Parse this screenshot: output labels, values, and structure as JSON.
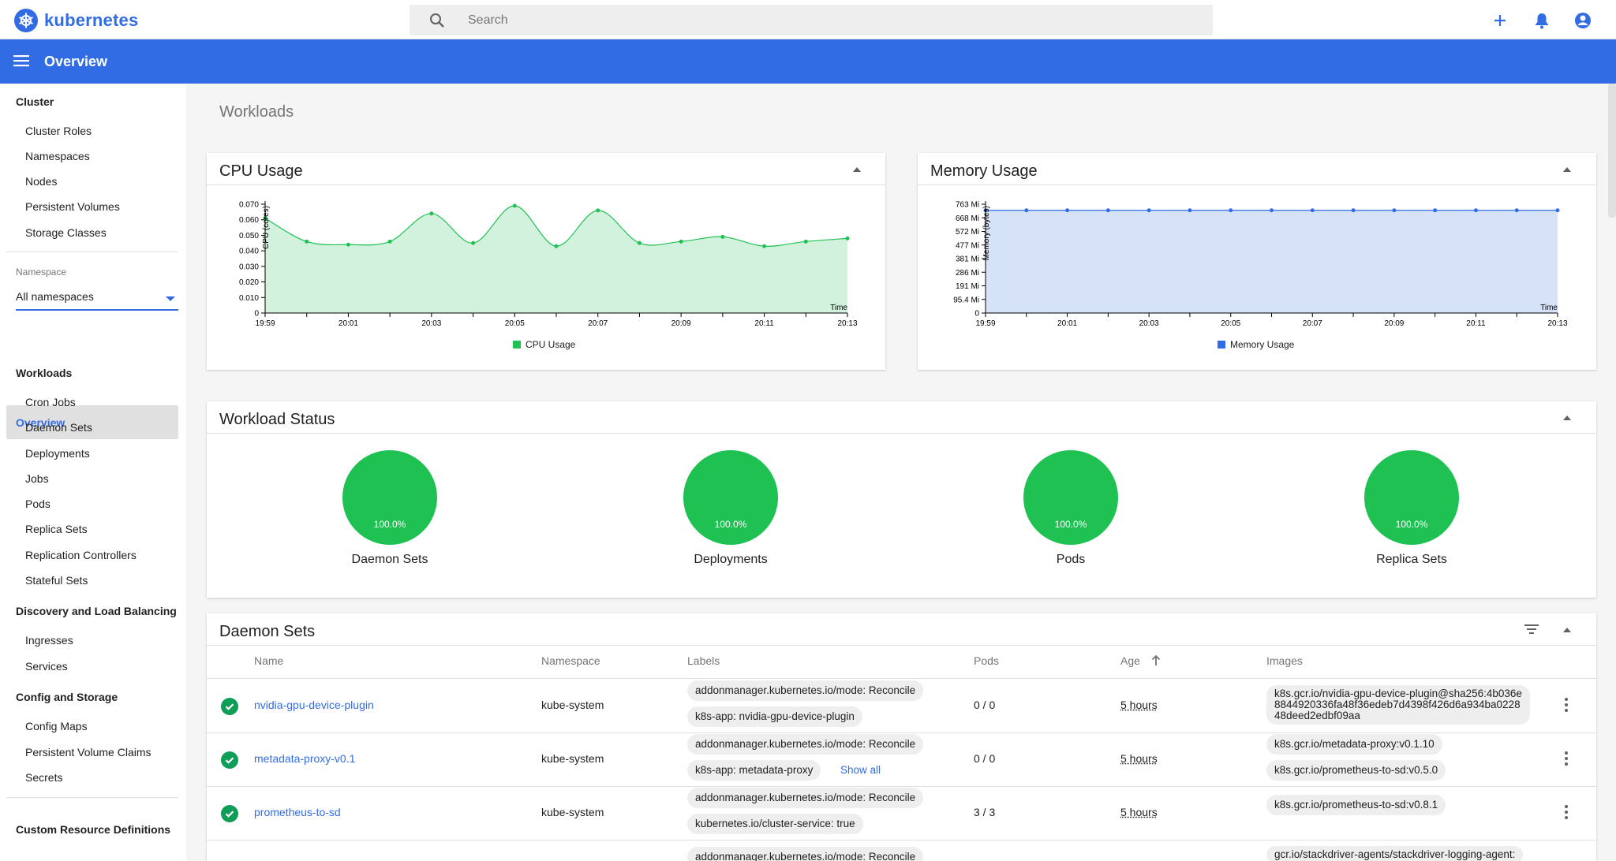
{
  "app": {
    "logo_text": "kubernetes"
  },
  "search": {
    "placeholder": "Search"
  },
  "toolbar": {
    "title": "Overview"
  },
  "sidebar": {
    "cluster": {
      "heading": "Cluster",
      "items": [
        "Cluster Roles",
        "Namespaces",
        "Nodes",
        "Persistent Volumes",
        "Storage Classes"
      ]
    },
    "namespace": {
      "label": "Namespace",
      "value": "All namespaces"
    },
    "overview": "Overview",
    "workloads": {
      "heading": "Workloads",
      "items": [
        "Cron Jobs",
        "Daemon Sets",
        "Deployments",
        "Jobs",
        "Pods",
        "Replica Sets",
        "Replication Controllers",
        "Stateful Sets"
      ]
    },
    "discovery": {
      "heading": "Discovery and Load Balancing",
      "items": [
        "Ingresses",
        "Services"
      ]
    },
    "config": {
      "heading": "Config and Storage",
      "items": [
        "Config Maps",
        "Persistent Volume Claims",
        "Secrets"
      ]
    },
    "crd": "Custom Resource Definitions"
  },
  "main": {
    "heading": "Workloads"
  },
  "cpu_card": {
    "title": "CPU Usage"
  },
  "memory_card": {
    "title": "Memory Usage"
  },
  "chart_data": [
    {
      "type": "area",
      "title": "CPU Usage",
      "xlabel": "Time",
      "ylabel": "CPU (cores)",
      "x": [
        "19:59",
        "20:00",
        "20:01",
        "20:02",
        "20:03",
        "20:04",
        "20:05",
        "20:06",
        "20:07",
        "20:08",
        "20:09",
        "20:10",
        "20:11",
        "20:12",
        "20:13"
      ],
      "x_ticks": [
        "19:59",
        "20:01",
        "20:03",
        "20:05",
        "20:07",
        "20:09",
        "20:11",
        "20:13"
      ],
      "y_ticks": [
        "0",
        "0.010",
        "0.020",
        "0.030",
        "0.040",
        "0.050",
        "0.060",
        "0.070"
      ],
      "ylim": [
        0,
        0.07
      ],
      "series": [
        {
          "name": "CPU Usage",
          "color": "#1fc252",
          "fill": "#d2f2dd",
          "values": [
            0.061,
            0.046,
            0.044,
            0.046,
            0.064,
            0.045,
            0.069,
            0.043,
            0.066,
            0.045,
            0.046,
            0.049,
            0.043,
            0.046,
            0.048
          ]
        }
      ],
      "legend": "bottom"
    },
    {
      "type": "area",
      "title": "Memory Usage",
      "xlabel": "Time",
      "ylabel": "Memory (bytes)",
      "x": [
        "19:59",
        "20:00",
        "20:01",
        "20:02",
        "20:03",
        "20:04",
        "20:05",
        "20:06",
        "20:07",
        "20:08",
        "20:09",
        "20:10",
        "20:11",
        "20:12",
        "20:13"
      ],
      "x_ticks": [
        "19:59",
        "20:01",
        "20:03",
        "20:05",
        "20:07",
        "20:09",
        "20:11",
        "20:13"
      ],
      "y_ticks": [
        "0",
        "95.4 Mi",
        "191 Mi",
        "286 Mi",
        "381 Mi",
        "477 Mi",
        "572 Mi",
        "668 Mi",
        "763 Mi"
      ],
      "ylim": [
        0,
        763
      ],
      "series": [
        {
          "name": "Memory Usage",
          "color": "#326ce5",
          "fill": "#d6e2f8",
          "values": [
            720,
            720,
            720,
            720,
            720,
            720,
            720,
            720,
            720,
            720,
            720,
            720,
            720,
            720,
            720
          ]
        }
      ],
      "legend": "bottom"
    }
  ],
  "workload_status": {
    "title": "Workload Status",
    "items": [
      {
        "value": "100.0%",
        "label": "Daemon Sets"
      },
      {
        "value": "100.0%",
        "label": "Deployments"
      },
      {
        "value": "100.0%",
        "label": "Pods"
      },
      {
        "value": "100.0%",
        "label": "Replica Sets"
      }
    ]
  },
  "daemon_sets": {
    "title": "Daemon Sets",
    "columns": [
      "Name",
      "Namespace",
      "Labels",
      "Pods",
      "Age",
      "Images"
    ],
    "rows": [
      {
        "name": "nvidia-gpu-device-plugin",
        "namespace": "kube-system",
        "labels": [
          "addonmanager.kubernetes.io/mode: Reconcile",
          "k8s-app: nvidia-gpu-device-plugin"
        ],
        "pods": "0 / 0",
        "age": "5 hours",
        "images": [
          "k8s.gcr.io/nvidia-gpu-device-plugin@sha256:4b036e",
          "8844920336fa48f36edeb7d4398f426d6a934ba0228",
          "48deed2edbf09aa"
        ]
      },
      {
        "name": "metadata-proxy-v0.1",
        "namespace": "kube-system",
        "labels": [
          "addonmanager.kubernetes.io/mode: Reconcile",
          "k8s-app: metadata-proxy"
        ],
        "show_all": "Show all",
        "pods": "0 / 0",
        "age": "5 hours",
        "images": [
          "k8s.gcr.io/metadata-proxy:v0.1.10",
          "k8s.gcr.io/prometheus-to-sd:v0.5.0"
        ]
      },
      {
        "name": "prometheus-to-sd",
        "namespace": "kube-system",
        "labels": [
          "addonmanager.kubernetes.io/mode: Reconcile",
          "kubernetes.io/cluster-service: true"
        ],
        "pods": "3 / 3",
        "age": "5 hours",
        "images": [
          "k8s.gcr.io/prometheus-to-sd:v0.8.1"
        ]
      },
      {
        "labels": [
          "addonmanager.kubernetes.io/mode: Reconcile"
        ],
        "images": [
          "gcr.io/stackdriver-agents/stackdriver-logging-agent:"
        ]
      }
    ]
  }
}
